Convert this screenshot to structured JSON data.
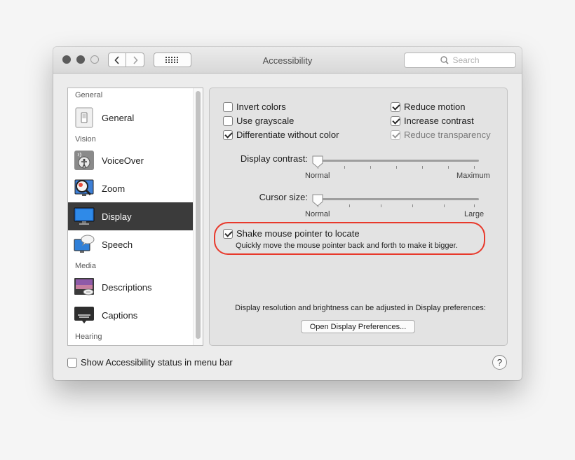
{
  "window": {
    "title": "Accessibility",
    "search_placeholder": "Search"
  },
  "sidebar": {
    "sections": {
      "general": "General",
      "vision": "Vision",
      "media": "Media",
      "hearing": "Hearing"
    },
    "items": [
      {
        "label": "General",
        "icon": "general-switch-icon"
      },
      {
        "label": "VoiceOver",
        "icon": "voiceover-icon"
      },
      {
        "label": "Zoom",
        "icon": "zoom-magnifier-icon"
      },
      {
        "label": "Display",
        "icon": "display-monitor-icon",
        "selected": true
      },
      {
        "label": "Speech",
        "icon": "speech-bubble-icon"
      },
      {
        "label": "Descriptions",
        "icon": "descriptions-icon"
      },
      {
        "label": "Captions",
        "icon": "captions-icon"
      }
    ]
  },
  "display": {
    "checkboxes": {
      "invert_colors": {
        "label": "Invert colors",
        "checked": false
      },
      "use_grayscale": {
        "label": "Use grayscale",
        "checked": false
      },
      "differentiate": {
        "label": "Differentiate without color",
        "checked": true
      },
      "reduce_motion": {
        "label": "Reduce motion",
        "checked": true
      },
      "increase_contrast": {
        "label": "Increase contrast",
        "checked": true
      },
      "reduce_transparency": {
        "label": "Reduce transparency",
        "checked": true,
        "disabled": true
      }
    },
    "contrast_slider": {
      "label": "Display contrast:",
      "min_label": "Normal",
      "max_label": "Maximum",
      "value": 0
    },
    "cursor_slider": {
      "label": "Cursor size:",
      "min_label": "Normal",
      "max_label": "Large",
      "value": 0
    },
    "shake": {
      "label": "Shake mouse pointer to locate",
      "description": "Quickly move the mouse pointer back and forth to make it bigger.",
      "checked": true
    },
    "note": "Display resolution and brightness can be adjusted in Display preferences:",
    "open_button": "Open Display Preferences..."
  },
  "footer": {
    "status_checkbox": {
      "label": "Show Accessibility status in menu bar",
      "checked": false
    },
    "help": "?"
  },
  "colors": {
    "highlight": "#e8392b",
    "selected_row": "#3b3b3b"
  }
}
